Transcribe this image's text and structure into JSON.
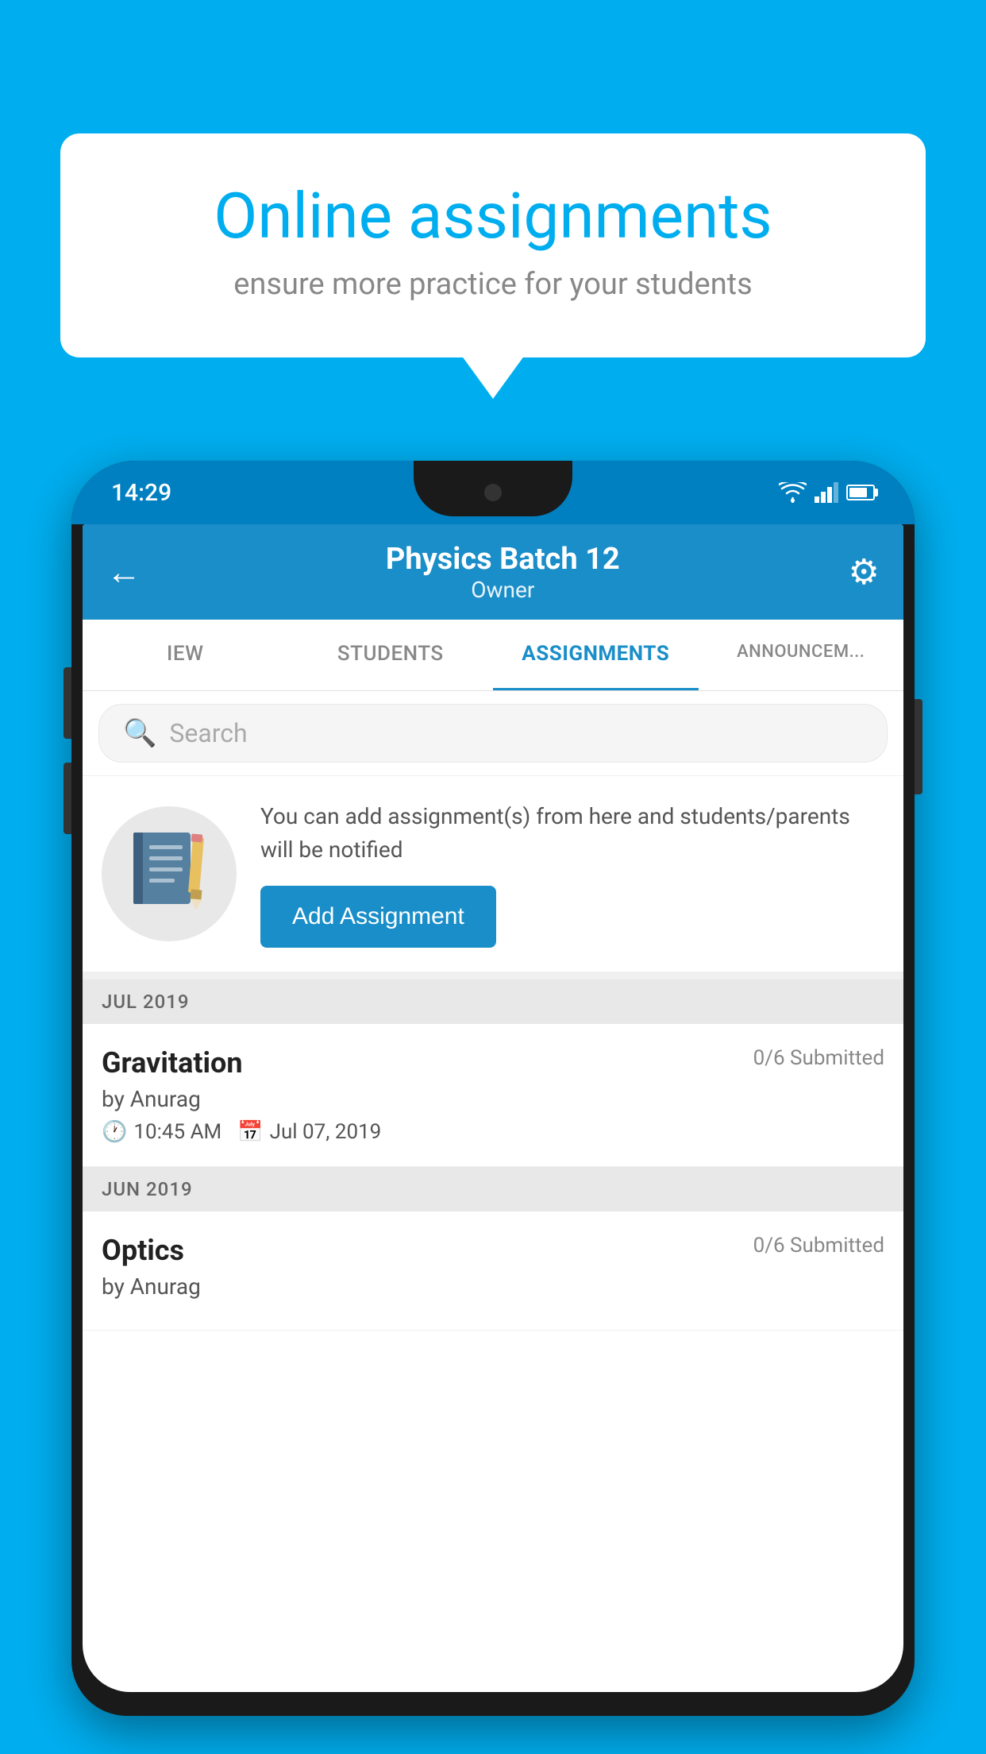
{
  "background_color": "#00AEEF",
  "speech_bubble": {
    "title": "Online assignments",
    "subtitle": "ensure more practice for your students"
  },
  "status_bar": {
    "time": "14:29"
  },
  "app_header": {
    "title": "Physics Batch 12",
    "subtitle": "Owner"
  },
  "tabs": [
    {
      "label": "IEW",
      "active": false
    },
    {
      "label": "STUDENTS",
      "active": false
    },
    {
      "label": "ASSIGNMENTS",
      "active": true
    },
    {
      "label": "ANNOUNCEM...",
      "active": false
    }
  ],
  "search": {
    "placeholder": "Search"
  },
  "promo": {
    "description": "You can add assignment(s) from here and students/parents will be notified",
    "button_label": "Add Assignment"
  },
  "sections": [
    {
      "month_label": "JUL 2019",
      "assignments": [
        {
          "name": "Gravitation",
          "submitted": "0/6 Submitted",
          "author": "by Anurag",
          "time": "10:45 AM",
          "date": "Jul 07, 2019"
        }
      ]
    },
    {
      "month_label": "JUN 2019",
      "assignments": [
        {
          "name": "Optics",
          "submitted": "0/6 Submitted",
          "author": "by Anurag",
          "time": "",
          "date": ""
        }
      ]
    }
  ],
  "icons": {
    "back_arrow": "←",
    "gear": "⚙",
    "search": "🔍",
    "clock": "🕐",
    "calendar": "📅"
  }
}
